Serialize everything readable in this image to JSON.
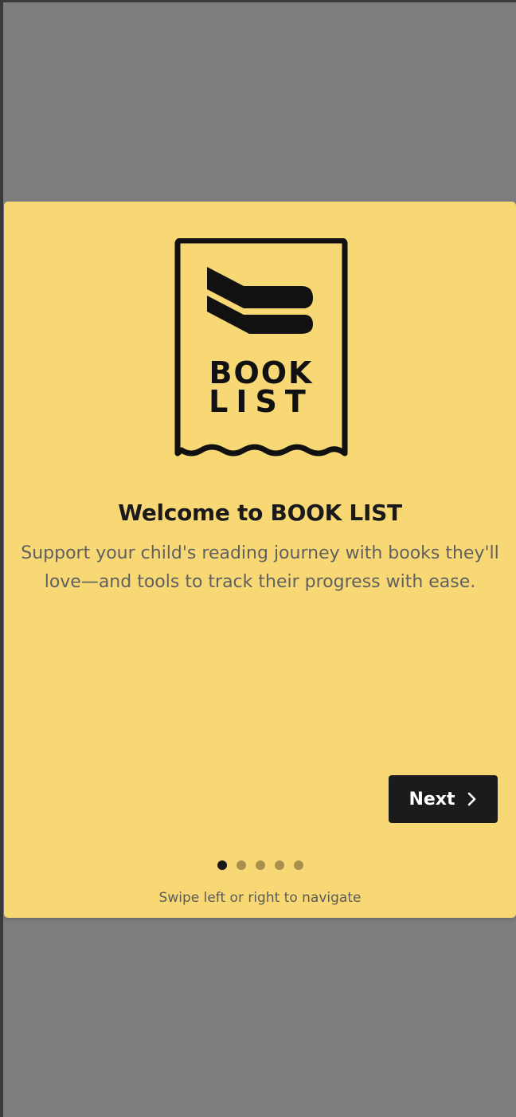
{
  "colors": {
    "backdrop": "#7d7d7d",
    "modal_background": "#f8d875",
    "button_background": "#1b1b1b",
    "dot_active": "#1a1a1a",
    "dot_inactive": "#a8904e"
  },
  "logo": {
    "line1": "BOOK",
    "line2": "LIST",
    "icon": "book-list-logo-icon"
  },
  "onboarding": {
    "title": "Welcome to BOOK LIST",
    "subtitle": "Support your child's reading journey with books they'll love—and tools to track their progress with ease.",
    "next_label": "Next",
    "next_icon": "chevron-right-icon",
    "hint": "Swipe left or right to navigate",
    "current_page": 1,
    "total_pages": 5
  }
}
